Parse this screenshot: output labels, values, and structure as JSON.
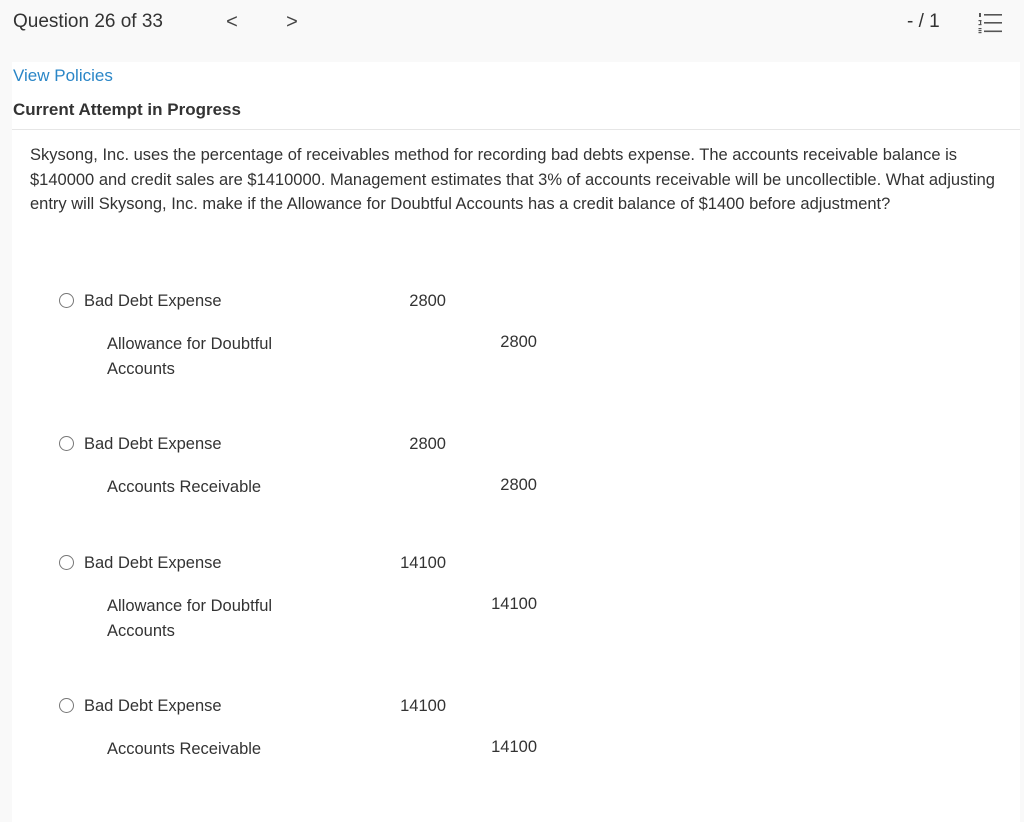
{
  "header": {
    "question_counter": "Question 26 of 33",
    "prev_glyph": "<",
    "next_glyph": ">",
    "score": "- / 1"
  },
  "links": {
    "view_policies": "View Policies"
  },
  "status": {
    "attempt": "Current Attempt in Progress"
  },
  "question": {
    "text": "Skysong, Inc. uses the percentage of receivables method for recording bad debts expense. The accounts receivable balance is $140000 and credit sales are $1410000. Management estimates that 3% of accounts receivable will be uncollectible. What adjusting entry will Skysong, Inc. make if the Allowance for Doubtful Accounts has a credit balance of $1400 before adjustment?"
  },
  "options": [
    {
      "debit_account": "Bad Debt Expense",
      "debit_amount": "2800",
      "credit_account": "Allowance for Doubtful Accounts",
      "credit_amount": "2800"
    },
    {
      "debit_account": "Bad Debt Expense",
      "debit_amount": "2800",
      "credit_account": "Accounts Receivable",
      "credit_amount": "2800"
    },
    {
      "debit_account": "Bad Debt Expense",
      "debit_amount": "14100",
      "credit_account": "Allowance for Doubtful Accounts",
      "credit_amount": "14100"
    },
    {
      "debit_account": "Bad Debt Expense",
      "debit_amount": "14100",
      "credit_account": "Accounts Receivable",
      "credit_amount": "14100"
    }
  ],
  "icons": {
    "prev": "chevron-left-icon",
    "next": "chevron-right-icon",
    "list": "numbered-list-icon"
  }
}
